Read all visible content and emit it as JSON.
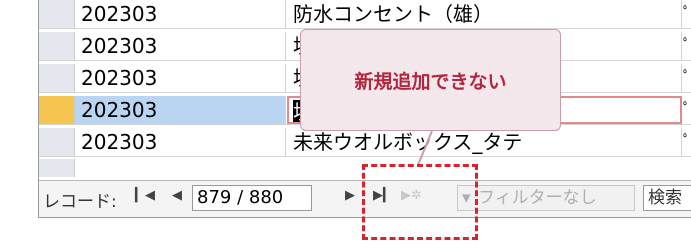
{
  "rows": [
    {
      "col1": "202303",
      "col2": "防水コンセント（雄）",
      "col3": "ﾟ"
    },
    {
      "col1": "202303",
      "col2": "埋込",
      "col3": "ﾟ"
    },
    {
      "col1": "202303",
      "col2": "埋込",
      "col3": "ﾟ"
    },
    {
      "col1": "202303",
      "col2": "埋込",
      "col3": "ﾟ"
    },
    {
      "col1": "202303",
      "col2": "未来ウオルボックス_タテ",
      "col3": "ﾟ"
    }
  ],
  "navigation": {
    "label": "レコード:",
    "first_icon": "first-record-icon",
    "prev_icon": "previous-record-icon",
    "record_position": "879 / 880",
    "next_icon": "next-record-icon",
    "last_icon": "last-record-icon",
    "new_icon": "new-record-icon",
    "filter_label": "フィルターなし",
    "filter_icon": "filter-icon",
    "search_label": "検索"
  },
  "callout": {
    "text": "新規追加できない",
    "background": "#f5e8ec",
    "text_color": "#b3263f"
  },
  "colors": {
    "current_row_selector": "#f5c54f",
    "current_row_highlight": "#b9d5f2",
    "highlight_border": "#d6232f"
  }
}
